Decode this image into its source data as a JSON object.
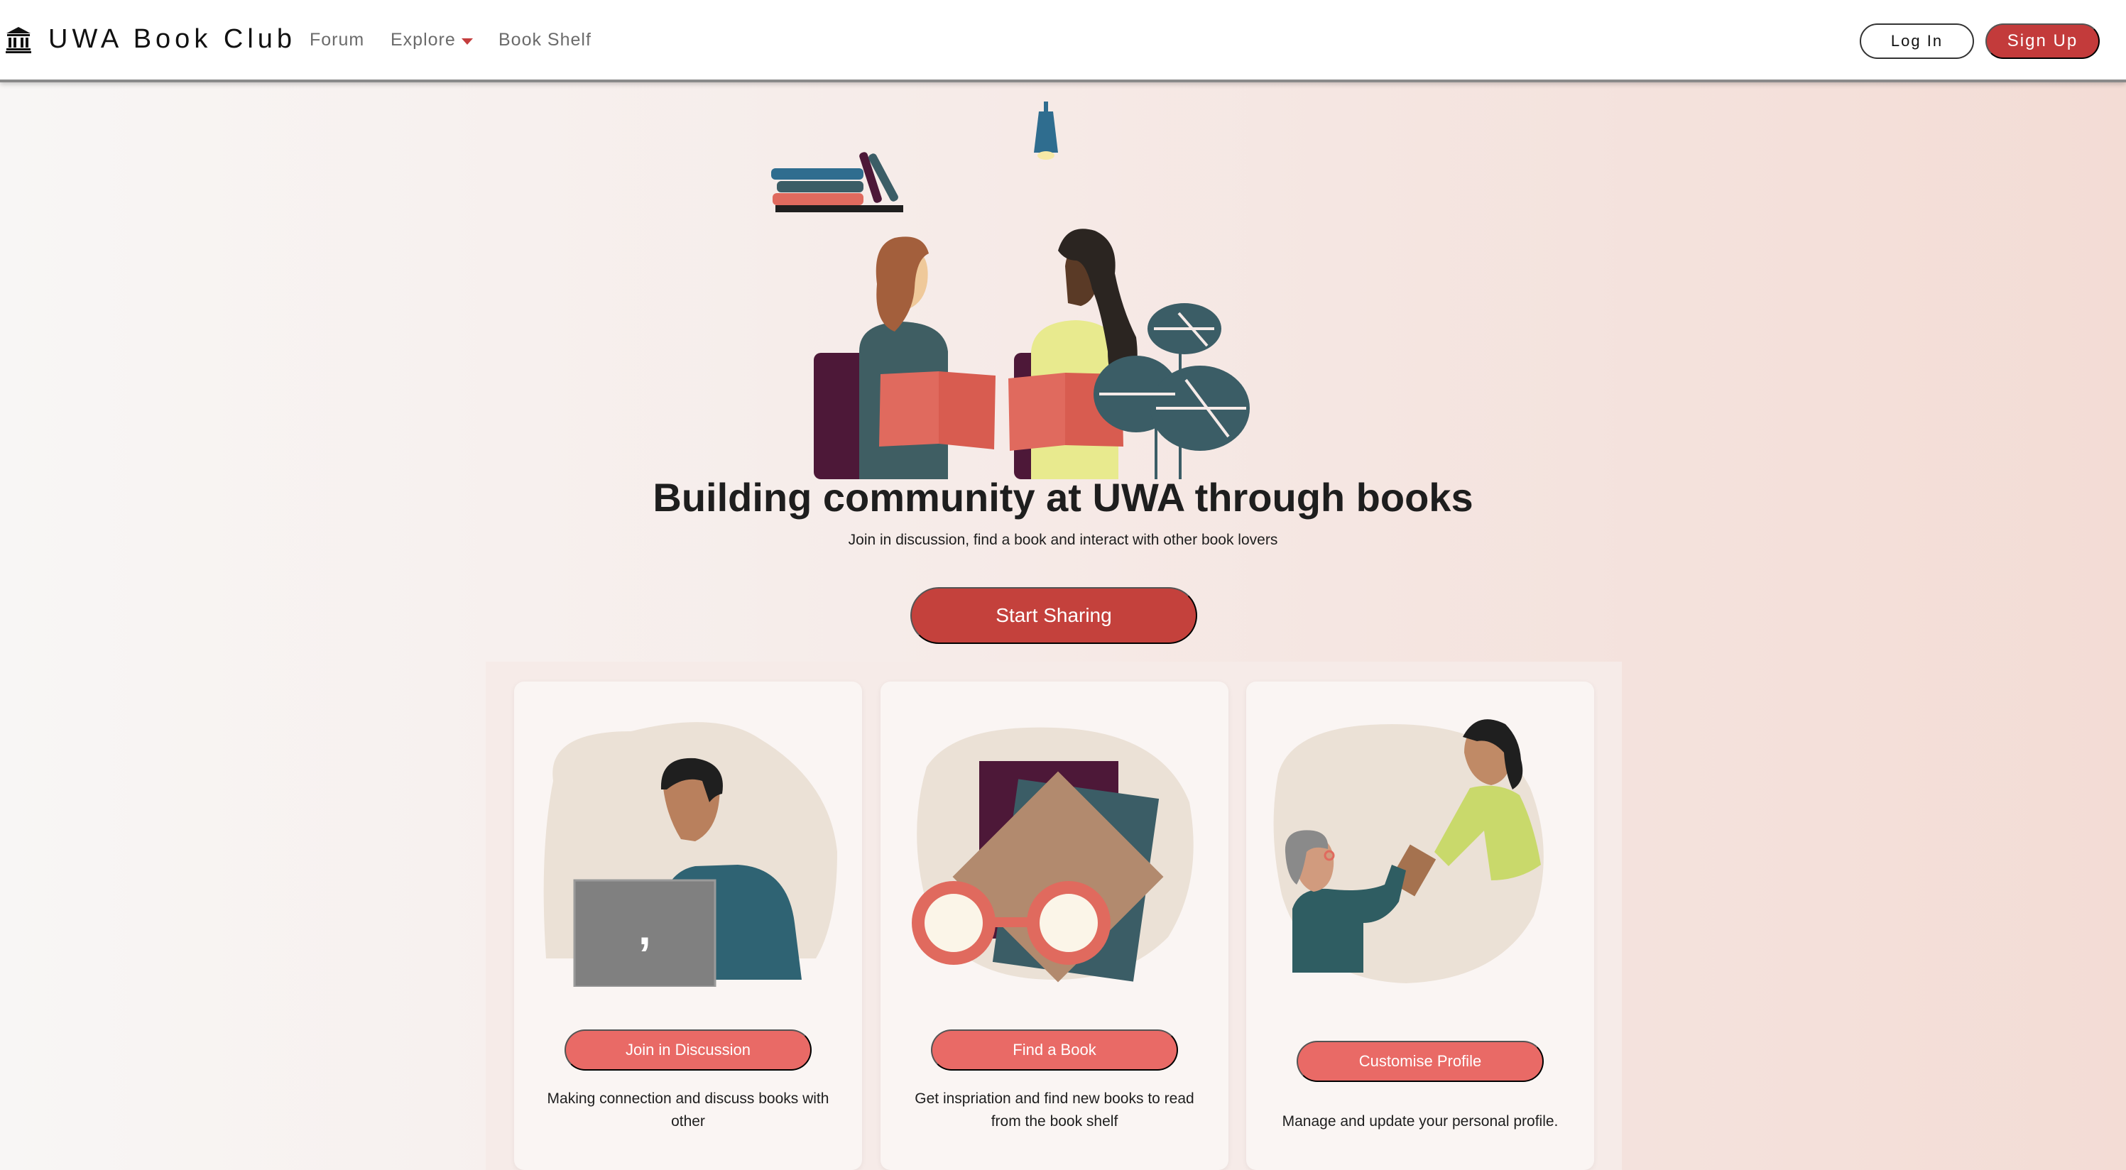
{
  "nav": {
    "brand_icon": "bank-building-icon",
    "brand": "UWA Book Club",
    "links": [
      {
        "label": "Forum"
      },
      {
        "label": "Explore",
        "icon": "caret-down-icon"
      },
      {
        "label": "Book Shelf"
      }
    ],
    "login_label": "Log In",
    "signup_label": "Sign Up"
  },
  "hero": {
    "title": "Building community at UWA through books",
    "subtitle": "Join in discussion, find a book and interact with other book lovers",
    "cta_label": "Start Sharing"
  },
  "features": [
    {
      "button": "Join in Discussion",
      "description": "Making connection and discuss books with other"
    },
    {
      "button": "Find a Book",
      "description": "Get inspriation and find new books to read from the book shelf"
    },
    {
      "button": "Customise Profile",
      "description": "Manage and update your personal profile."
    }
  ],
  "colors": {
    "accent": "#c33b3b",
    "card_button": "#e96a66",
    "navbar": "#ffffff"
  }
}
